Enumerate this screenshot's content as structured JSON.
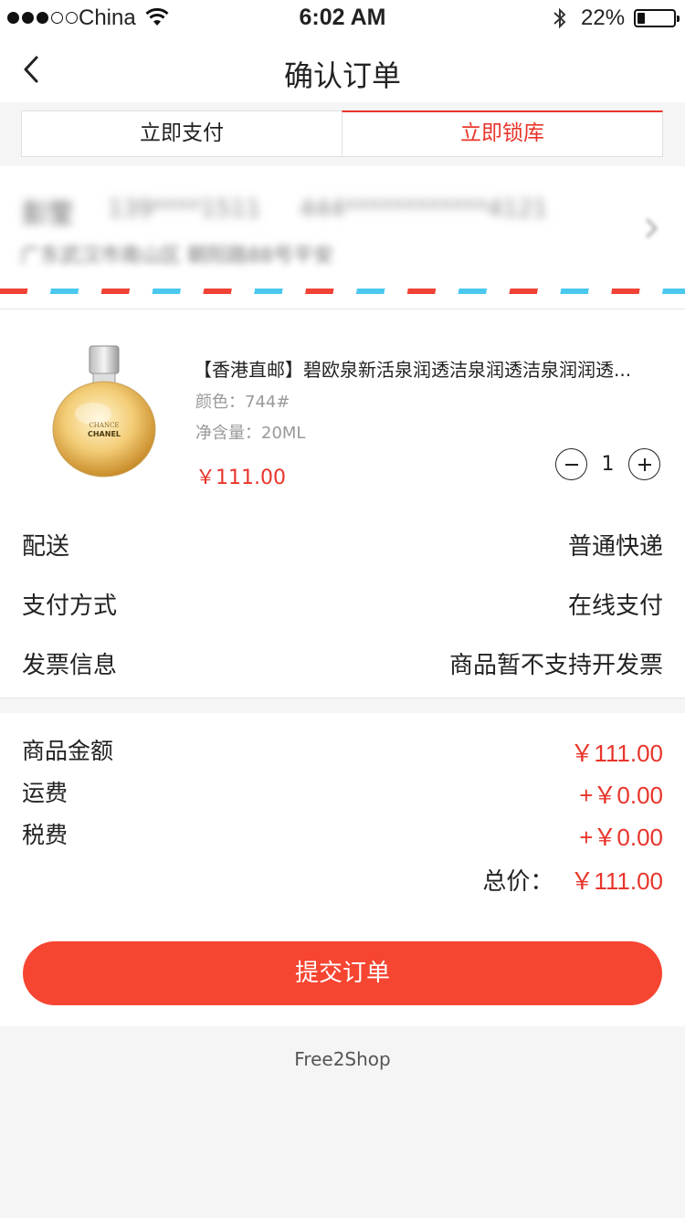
{
  "status_bar": {
    "carrier": "China",
    "time": "6:02 AM",
    "battery": "22%",
    "battery_level": 0.22
  },
  "navbar": {
    "title": "确认订单",
    "back_icon": "chevron-left-icon"
  },
  "tabs": [
    {
      "label": "立即支付",
      "active": false
    },
    {
      "label": "立即锁库",
      "active": true
    }
  ],
  "address": {
    "name": "彭莹",
    "phone": "139****1511",
    "card": "444************4121",
    "line": "广东武汉市南山区 朝阳路88号平安",
    "arrow_icon": "chevron-right-icon"
  },
  "product": {
    "name": "【香港直邮】碧欧泉新活泉润透洁泉润透洁泉润润透...",
    "color": "颜色：744#",
    "volume": "净含量：20ML",
    "price": "￥111.00",
    "quantity": "1",
    "image_label_top": "CHANCE",
    "image_label_brand": "CHANEL"
  },
  "info": [
    {
      "label": "配送",
      "value": "普通快递"
    },
    {
      "label": "支付方式",
      "value": "在线支付"
    },
    {
      "label": "发票信息",
      "value": "商品暂不支持开发票"
    }
  ],
  "summary": {
    "rows": [
      {
        "label": "商品金额",
        "value": "￥111.00"
      },
      {
        "label": "运费",
        "value": "+￥0.00"
      },
      {
        "label": "税费",
        "value": "+￥0.00"
      }
    ],
    "total_label": "总价：",
    "total_value": "￥111.00"
  },
  "submit_label": "提交订单",
  "footer": "Free2Shop",
  "colors": {
    "accent": "#e8352b",
    "button": "#f64531",
    "stripe_red": "#f14236",
    "stripe_blue": "#4ac8ee"
  }
}
